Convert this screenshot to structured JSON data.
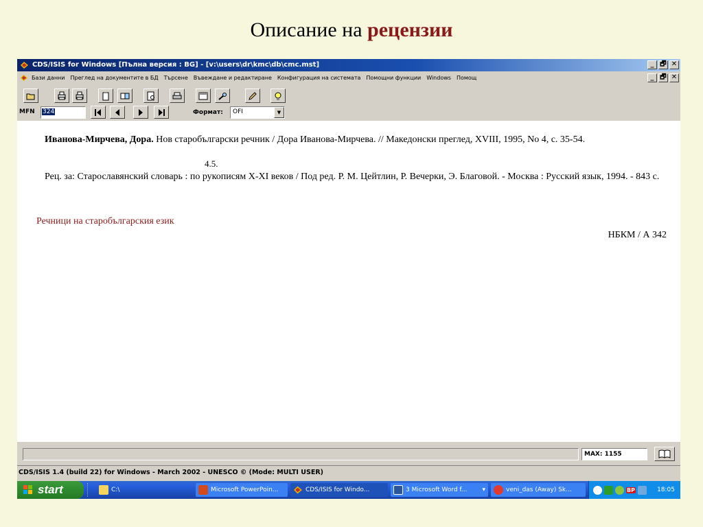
{
  "slide": {
    "title_plain": "Описание на ",
    "title_highlight": "рецензии"
  },
  "window": {
    "title": "CDS/ISIS for Windows [Пълна версия : BG] - [v:\\users\\dr\\kmc\\db\\cmc.mst]",
    "minimize": "_",
    "restore": "🗗",
    "close": "✕"
  },
  "menu": {
    "items": [
      "Бази данни",
      "Преглед на документите в БД",
      "Търсене",
      "Въвеждане и редактиране",
      "Конфигурация на системата",
      "Помощни функции",
      "Windows",
      "Помощ"
    ],
    "minimize": "_",
    "restore": "🗗",
    "close": "✕"
  },
  "nav": {
    "mfn_label": "MFN",
    "mfn_value": "324",
    "format_label": "Формат:",
    "format_value": "OFI",
    "format_arrow": "▼"
  },
  "record": {
    "author": "Иванова-Мирчева, Дора.",
    "citation": "  Нов старобългарски речник / Дора Иванова-Мирчева. // Македонски преглед, XVIII, 1995, No 4,  с. 35-54.",
    "number": "4.5.",
    "review_of": "Рец. за: Старославянский словарь : по рукописям X-XI веков / Под ред. Р. М. Цейтлин, Р. Вечерки, Э. Благовой. - Москва : Русский язык, 1994. - 843 с.",
    "subject": "Речници на старобългарския език",
    "shelfmark": "НБКМ / А 342"
  },
  "status": {
    "max_label": "MAX: 1155"
  },
  "info": "CDS/ISIS 1.4 (build 22) for Windows - March 2002 - UNESCO ©  (Mode: MULTI USER)",
  "taskbar": {
    "start": "start",
    "items": [
      {
        "label": "C:\\"
      },
      {
        "label": "Microsoft PowerPoin..."
      },
      {
        "label": "CDS/ISIS for Windo..."
      },
      {
        "label": "3 Microsoft Word f...",
        "arrow": "▾"
      },
      {
        "label": "veni_das (Away) Sk..."
      }
    ],
    "tray_bp": "BP",
    "clock": "18:05"
  },
  "colors": {
    "highlight": "#8b1a1a",
    "slide_bg": "#f7f7dd",
    "titlebar": "#0a246a",
    "taskbar": "#245edb"
  }
}
